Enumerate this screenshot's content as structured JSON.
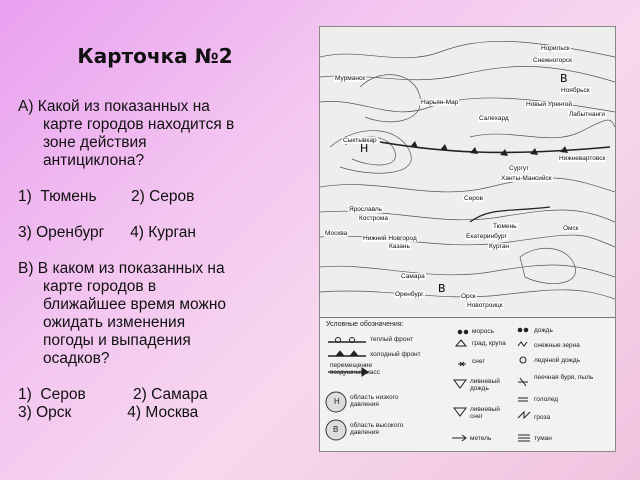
{
  "title": "Карточка №2",
  "question_a": {
    "line1": "А) Какой из показанных на",
    "line2": "карте городов находится в",
    "line3": "зоне действия",
    "line4": "антициклона?",
    "options_row1": "1)  Тюмень        2) Серов",
    "options_row2": "3) Оренбург      4) Курган"
  },
  "question_b": {
    "line1": "В) В каком из показанных на",
    "line2": "карте городов в",
    "line3": "ближайшее время можно",
    "line4": "ожидать изменения",
    "line5": "погоды и выпадения",
    "line6": "осадков?",
    "options_row1": "1)  Серов           2) Самара",
    "options_row2": "3) Орск             4) Москва"
  },
  "map": {
    "cities": [
      "Норильск",
      "Снежногорск",
      "Мурманск",
      "Нарьян-Мар",
      "Салехард",
      "Новый Уренгой",
      "Лабытнанги",
      "Ноябрьск",
      "Сыктывкар",
      "Ханты-Мансийск",
      "Сургут",
      "Нижневартовск",
      "Серов",
      "Ярославль",
      "Кострома",
      "Москва",
      "Нижний Новгород",
      "Казань",
      "Тюмень",
      "Екатеринбург",
      "Курган",
      "Омск",
      "Самара",
      "Оренбург",
      "Орск",
      "Новотроицк",
      "Мурманск"
    ],
    "center_labels": [
      "Н",
      "В",
      "В"
    ]
  },
  "legend": {
    "heading": "Условные обозначения:",
    "items": [
      "теплый фронт",
      "холодный фронт",
      "перемещение воздушных масс",
      "область низкого давления",
      "область высокого давления",
      "морось",
      "град, крупа",
      "снег",
      "ливневый дождь",
      "ливневый снег",
      "метель",
      "дождь",
      "снежные зерна",
      "ледяной дождь",
      "пеечная буря, пыль",
      "гололед",
      "гроза",
      "туман"
    ],
    "h_symbol": "Н",
    "b_symbol": "В"
  }
}
